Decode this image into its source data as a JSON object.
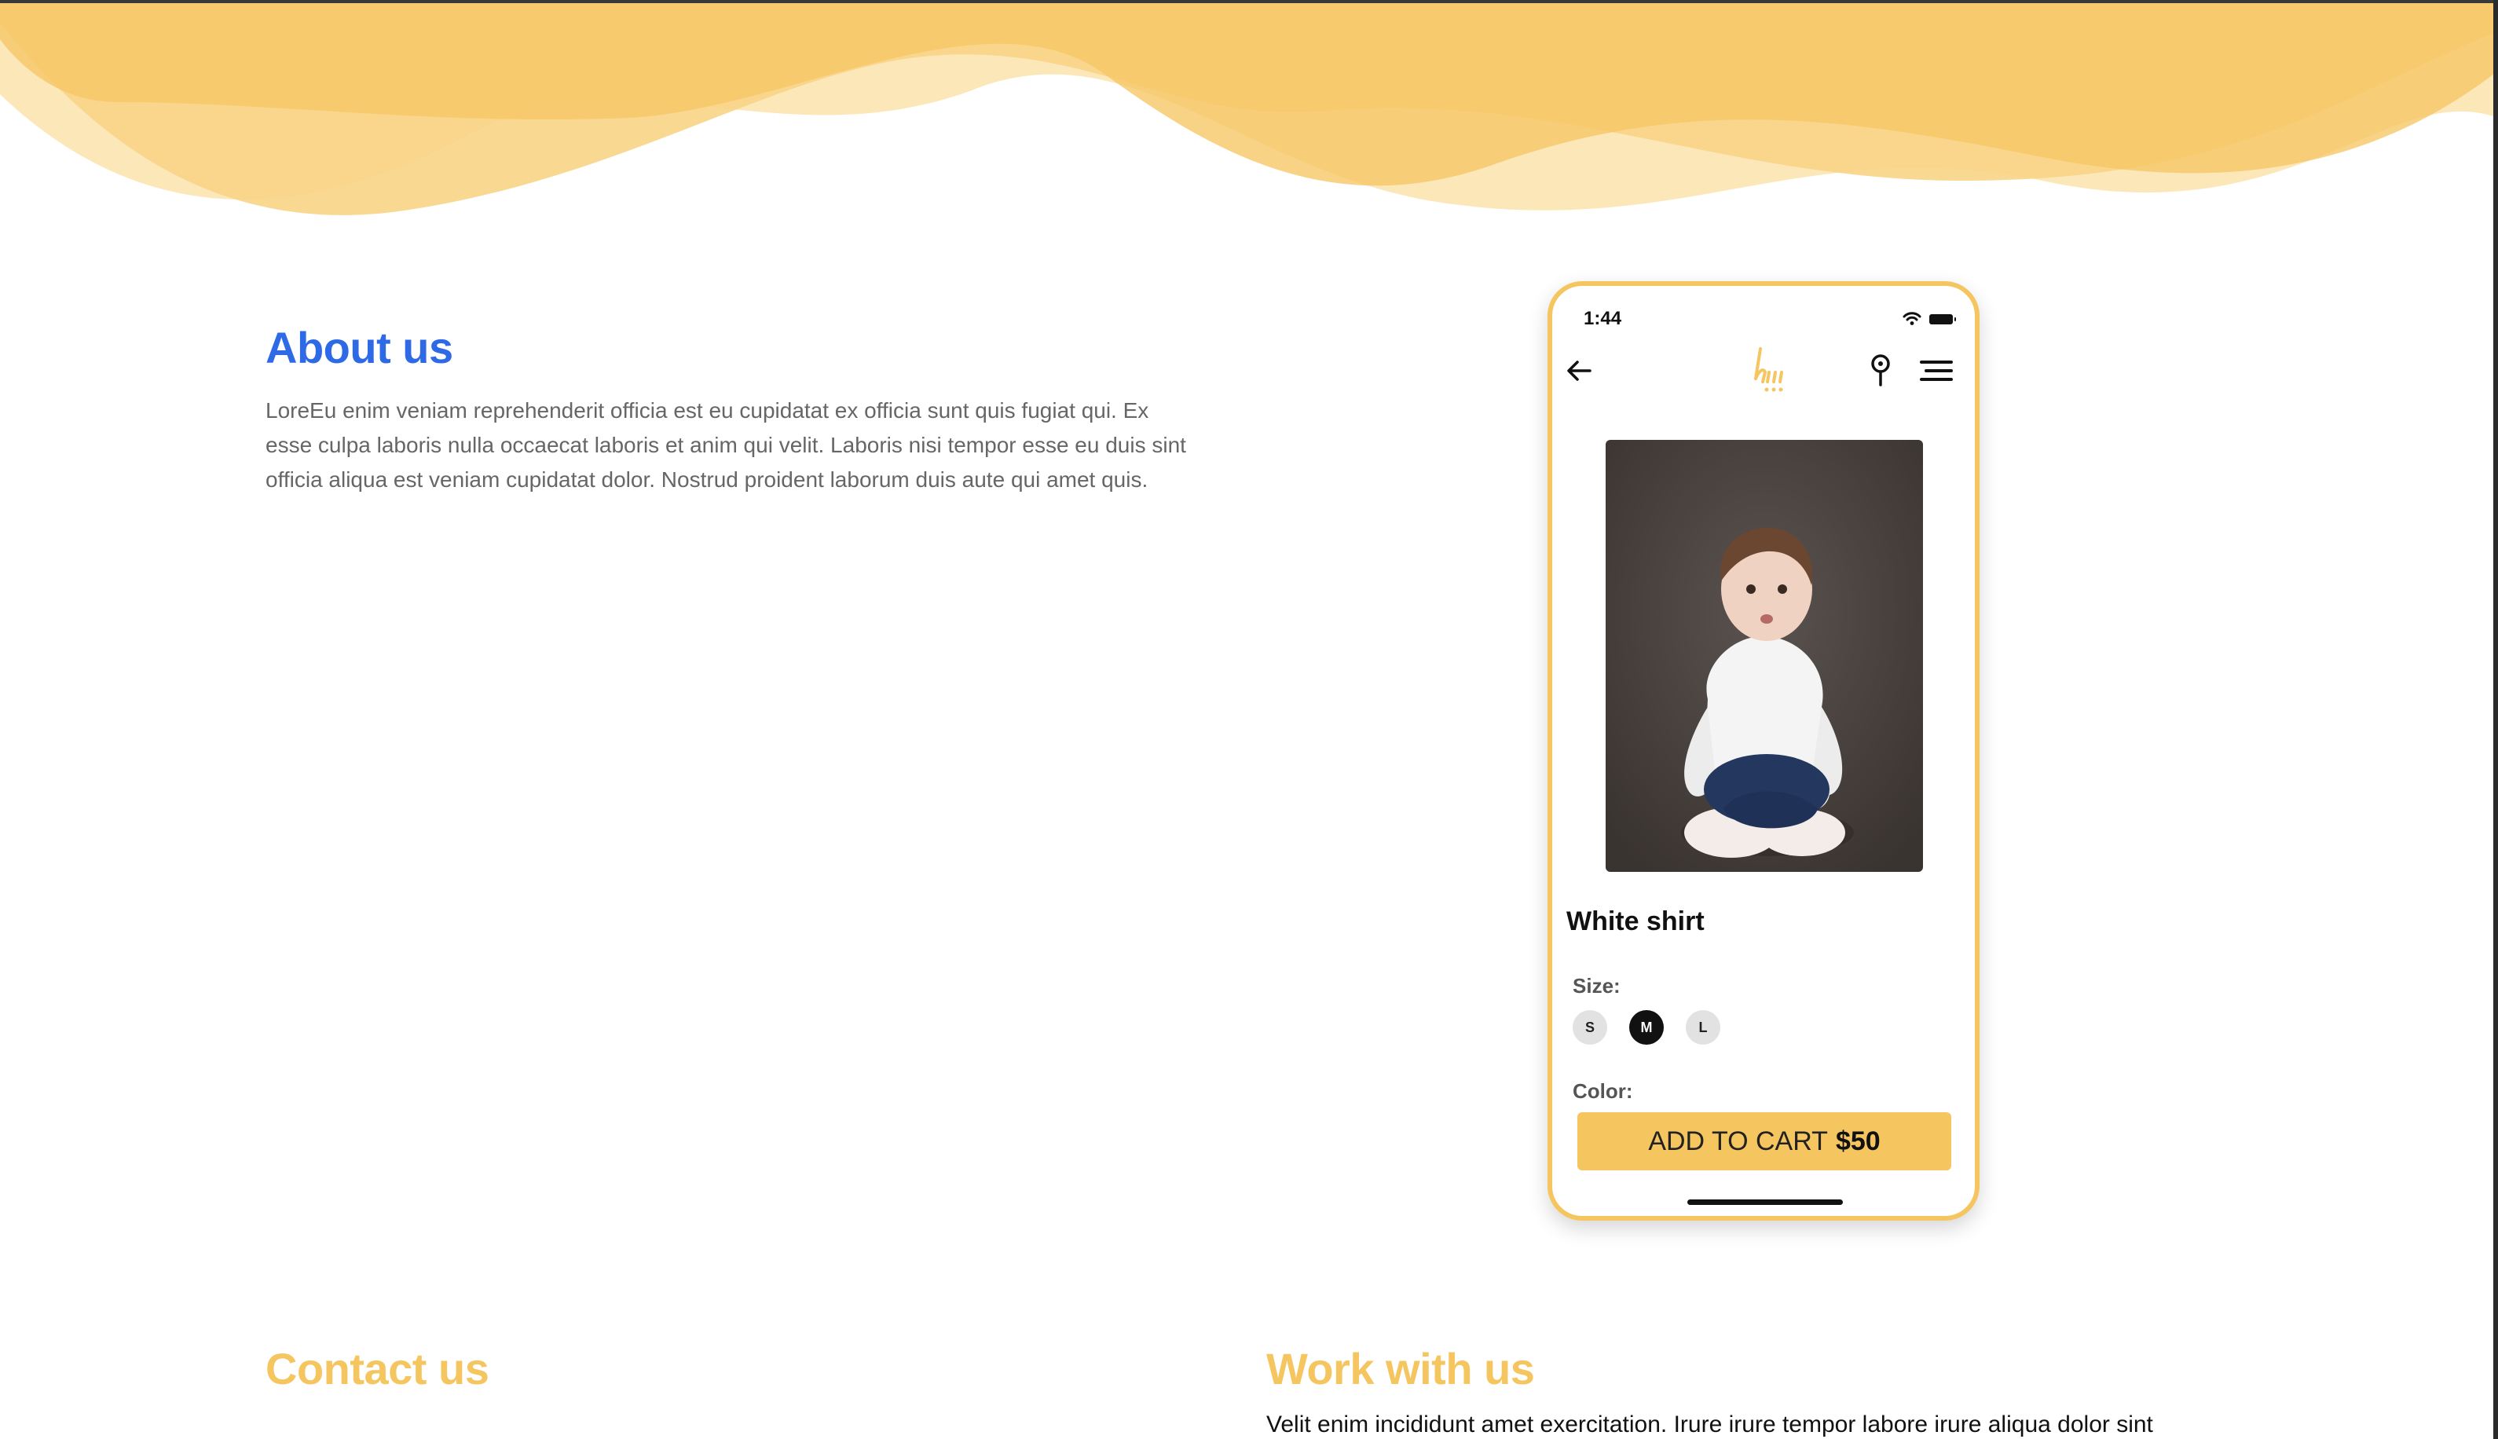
{
  "about": {
    "title": "About us",
    "body": "LoreEu enim veniam reprehenderit officia est eu cupidatat ex officia sunt quis fugiat qui. Ex esse culpa laboris nulla occaecat laboris et anim qui velit. Laboris nisi tempor esse eu duis sint officia aliqua est veniam cupidatat dolor. Nostrud proident laborum duis aute qui amet quis."
  },
  "phone": {
    "status_time": "1:44",
    "nav_icons": [
      "arrow-left-icon",
      "brand-logo",
      "map-pin-icon",
      "menu-icon"
    ],
    "product": {
      "name": "White shirt",
      "size_label": "Size:",
      "sizes": [
        "S",
        "M",
        "L"
      ],
      "selected_size": "M",
      "color_label": "Color:",
      "cta_label": "ADD TO CART",
      "price": "$50"
    }
  },
  "contact": {
    "title": "Contact us"
  },
  "work": {
    "title": "Work with us",
    "body": "Velit enim incididunt amet exercitation. Irure irure tempor labore irure aliqua dolor sint"
  },
  "colors": {
    "accent_yellow": "#f5c55f",
    "heading_blue": "#2f6ae6"
  }
}
